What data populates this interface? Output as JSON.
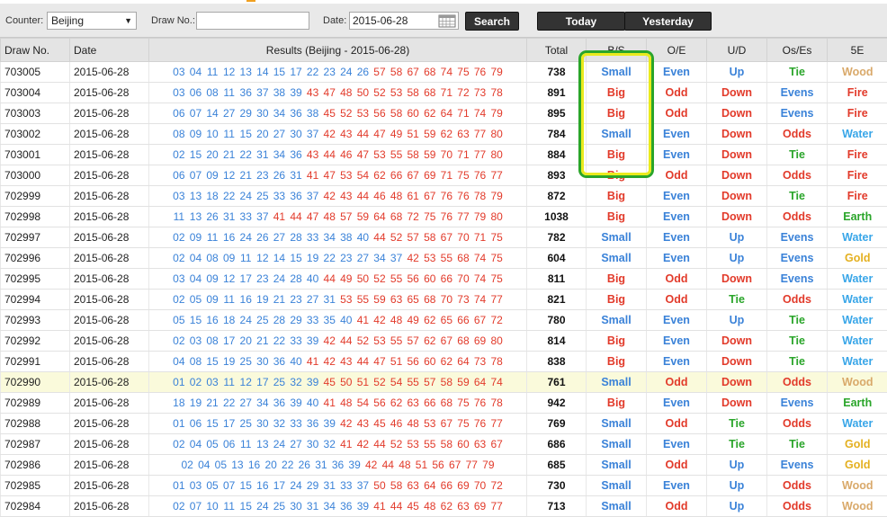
{
  "toolbar": {
    "counter_label": "Counter:",
    "counter_value": "Beijing",
    "drawno_label": "Draw No.:",
    "drawno_value": "",
    "date_label": "Date:",
    "date_value": "2015-06-28",
    "search_label": "Search",
    "today_label": "Today",
    "yesterday_label": "Yesterday"
  },
  "table": {
    "headers": [
      "Draw No.",
      "Date",
      "Results (Beijing - 2015-06-28)",
      "Total",
      "B/S",
      "O/E",
      "U/D",
      "Os/Es",
      "5E"
    ],
    "rows": [
      {
        "draw": "703005",
        "date": "2015-06-28",
        "nums": [
          "03",
          "04",
          "11",
          "12",
          "13",
          "14",
          "15",
          "17",
          "22",
          "23",
          "24",
          "26",
          "57",
          "58",
          "67",
          "68",
          "74",
          "75",
          "76",
          "79"
        ],
        "total": "738",
        "bs": "Small",
        "oe": "Even",
        "ud": "Up",
        "os": "Tie",
        "fe": "Wood"
      },
      {
        "draw": "703004",
        "date": "2015-06-28",
        "nums": [
          "03",
          "06",
          "08",
          "11",
          "36",
          "37",
          "38",
          "39",
          "43",
          "47",
          "48",
          "50",
          "52",
          "53",
          "58",
          "68",
          "71",
          "72",
          "73",
          "78"
        ],
        "total": "891",
        "bs": "Big",
        "oe": "Odd",
        "ud": "Down",
        "os": "Evens",
        "fe": "Fire"
      },
      {
        "draw": "703003",
        "date": "2015-06-28",
        "nums": [
          "06",
          "07",
          "14",
          "27",
          "29",
          "30",
          "34",
          "36",
          "38",
          "45",
          "52",
          "53",
          "56",
          "58",
          "60",
          "62",
          "64",
          "71",
          "74",
          "79"
        ],
        "total": "895",
        "bs": "Big",
        "oe": "Odd",
        "ud": "Down",
        "os": "Evens",
        "fe": "Fire"
      },
      {
        "draw": "703002",
        "date": "2015-06-28",
        "nums": [
          "08",
          "09",
          "10",
          "11",
          "15",
          "20",
          "27",
          "30",
          "37",
          "42",
          "43",
          "44",
          "47",
          "49",
          "51",
          "59",
          "62",
          "63",
          "77",
          "80"
        ],
        "total": "784",
        "bs": "Small",
        "oe": "Even",
        "ud": "Down",
        "os": "Odds",
        "fe": "Water"
      },
      {
        "draw": "703001",
        "date": "2015-06-28",
        "nums": [
          "02",
          "15",
          "20",
          "21",
          "22",
          "31",
          "34",
          "36",
          "43",
          "44",
          "46",
          "47",
          "53",
          "55",
          "58",
          "59",
          "70",
          "71",
          "77",
          "80"
        ],
        "total": "884",
        "bs": "Big",
        "oe": "Even",
        "ud": "Down",
        "os": "Tie",
        "fe": "Fire"
      },
      {
        "draw": "703000",
        "date": "2015-06-28",
        "nums": [
          "06",
          "07",
          "09",
          "12",
          "21",
          "23",
          "26",
          "31",
          "41",
          "47",
          "53",
          "54",
          "62",
          "66",
          "67",
          "69",
          "71",
          "75",
          "76",
          "77"
        ],
        "total": "893",
        "bs": "Big",
        "oe": "Odd",
        "ud": "Down",
        "os": "Odds",
        "fe": "Fire"
      },
      {
        "draw": "702999",
        "date": "2015-06-28",
        "nums": [
          "03",
          "13",
          "18",
          "22",
          "24",
          "25",
          "33",
          "36",
          "37",
          "42",
          "43",
          "44",
          "46",
          "48",
          "61",
          "67",
          "76",
          "76",
          "78",
          "79"
        ],
        "total": "872",
        "bs": "Big",
        "oe": "Even",
        "ud": "Down",
        "os": "Tie",
        "fe": "Fire"
      },
      {
        "draw": "702998",
        "date": "2015-06-28",
        "nums": [
          "11",
          "13",
          "26",
          "31",
          "33",
          "37",
          "41",
          "44",
          "47",
          "48",
          "57",
          "59",
          "64",
          "68",
          "72",
          "75",
          "76",
          "77",
          "79",
          "80"
        ],
        "total": "1038",
        "bs": "Big",
        "oe": "Even",
        "ud": "Down",
        "os": "Odds",
        "fe": "Earth"
      },
      {
        "draw": "702997",
        "date": "2015-06-28",
        "nums": [
          "02",
          "09",
          "11",
          "16",
          "24",
          "26",
          "27",
          "28",
          "33",
          "34",
          "38",
          "40",
          "44",
          "52",
          "57",
          "58",
          "67",
          "70",
          "71",
          "75"
        ],
        "total": "782",
        "bs": "Small",
        "oe": "Even",
        "ud": "Up",
        "os": "Evens",
        "fe": "Water"
      },
      {
        "draw": "702996",
        "date": "2015-06-28",
        "nums": [
          "02",
          "04",
          "08",
          "09",
          "11",
          "12",
          "14",
          "15",
          "19",
          "22",
          "23",
          "27",
          "34",
          "37",
          "42",
          "53",
          "55",
          "68",
          "74",
          "75"
        ],
        "total": "604",
        "bs": "Small",
        "oe": "Even",
        "ud": "Up",
        "os": "Evens",
        "fe": "Gold"
      },
      {
        "draw": "702995",
        "date": "2015-06-28",
        "nums": [
          "03",
          "04",
          "09",
          "12",
          "17",
          "23",
          "24",
          "28",
          "40",
          "44",
          "49",
          "50",
          "52",
          "55",
          "56",
          "60",
          "66",
          "70",
          "74",
          "75"
        ],
        "total": "811",
        "bs": "Big",
        "oe": "Odd",
        "ud": "Down",
        "os": "Evens",
        "fe": "Water"
      },
      {
        "draw": "702994",
        "date": "2015-06-28",
        "nums": [
          "02",
          "05",
          "09",
          "11",
          "16",
          "19",
          "21",
          "23",
          "27",
          "31",
          "53",
          "55",
          "59",
          "63",
          "65",
          "68",
          "70",
          "73",
          "74",
          "77"
        ],
        "total": "821",
        "bs": "Big",
        "oe": "Odd",
        "ud": "Tie",
        "os": "Odds",
        "fe": "Water"
      },
      {
        "draw": "702993",
        "date": "2015-06-28",
        "nums": [
          "05",
          "15",
          "16",
          "18",
          "24",
          "25",
          "28",
          "29",
          "33",
          "35",
          "40",
          "41",
          "42",
          "48",
          "49",
          "62",
          "65",
          "66",
          "67",
          "72"
        ],
        "total": "780",
        "bs": "Small",
        "oe": "Even",
        "ud": "Up",
        "os": "Tie",
        "fe": "Water"
      },
      {
        "draw": "702992",
        "date": "2015-06-28",
        "nums": [
          "02",
          "03",
          "08",
          "17",
          "20",
          "21",
          "22",
          "33",
          "39",
          "42",
          "44",
          "52",
          "53",
          "55",
          "57",
          "62",
          "67",
          "68",
          "69",
          "80"
        ],
        "total": "814",
        "bs": "Big",
        "oe": "Even",
        "ud": "Down",
        "os": "Tie",
        "fe": "Water"
      },
      {
        "draw": "702991",
        "date": "2015-06-28",
        "nums": [
          "04",
          "08",
          "15",
          "19",
          "25",
          "30",
          "36",
          "40",
          "41",
          "42",
          "43",
          "44",
          "47",
          "51",
          "56",
          "60",
          "62",
          "64",
          "73",
          "78"
        ],
        "total": "838",
        "bs": "Big",
        "oe": "Even",
        "ud": "Down",
        "os": "Tie",
        "fe": "Water"
      },
      {
        "draw": "702990",
        "date": "2015-06-28",
        "nums": [
          "01",
          "02",
          "03",
          "11",
          "12",
          "17",
          "25",
          "32",
          "39",
          "45",
          "50",
          "51",
          "52",
          "54",
          "55",
          "57",
          "58",
          "59",
          "64",
          "74"
        ],
        "total": "761",
        "bs": "Small",
        "oe": "Odd",
        "ud": "Down",
        "os": "Odds",
        "fe": "Wood"
      },
      {
        "draw": "702989",
        "date": "2015-06-28",
        "nums": [
          "18",
          "19",
          "21",
          "22",
          "27",
          "34",
          "36",
          "39",
          "40",
          "41",
          "48",
          "54",
          "56",
          "62",
          "63",
          "66",
          "68",
          "75",
          "76",
          "78"
        ],
        "total": "942",
        "bs": "Big",
        "oe": "Even",
        "ud": "Down",
        "os": "Evens",
        "fe": "Earth"
      },
      {
        "draw": "702988",
        "date": "2015-06-28",
        "nums": [
          "01",
          "06",
          "15",
          "17",
          "25",
          "30",
          "32",
          "33",
          "36",
          "39",
          "42",
          "43",
          "45",
          "46",
          "48",
          "53",
          "67",
          "75",
          "76",
          "77"
        ],
        "total": "769",
        "bs": "Small",
        "oe": "Odd",
        "ud": "Tie",
        "os": "Odds",
        "fe": "Water"
      },
      {
        "draw": "702987",
        "date": "2015-06-28",
        "nums": [
          "02",
          "04",
          "05",
          "06",
          "11",
          "13",
          "24",
          "27",
          "30",
          "32",
          "41",
          "42",
          "44",
          "52",
          "53",
          "55",
          "58",
          "60",
          "63",
          "67"
        ],
        "total": "686",
        "bs": "Small",
        "oe": "Even",
        "ud": "Tie",
        "os": "Tie",
        "fe": "Gold"
      },
      {
        "draw": "702986",
        "date": "2015-06-28",
        "nums": [
          "02",
          "04",
          "05",
          "13",
          "16",
          "20",
          "22",
          "26",
          "31",
          "36",
          "39",
          "42",
          "44",
          "48",
          "51",
          "56",
          "67",
          "77",
          "79"
        ],
        "total": "685",
        "bs": "Small",
        "oe": "Odd",
        "ud": "Up",
        "os": "Evens",
        "fe": "Gold"
      },
      {
        "draw": "702985",
        "date": "2015-06-28",
        "nums": [
          "01",
          "03",
          "05",
          "07",
          "15",
          "16",
          "17",
          "24",
          "29",
          "31",
          "33",
          "37",
          "50",
          "58",
          "63",
          "64",
          "66",
          "69",
          "70",
          "72"
        ],
        "total": "730",
        "bs": "Small",
        "oe": "Even",
        "ud": "Up",
        "os": "Odds",
        "fe": "Wood"
      },
      {
        "draw": "702984",
        "date": "2015-06-28",
        "nums": [
          "02",
          "07",
          "10",
          "11",
          "15",
          "24",
          "25",
          "30",
          "31",
          "34",
          "36",
          "39",
          "41",
          "44",
          "45",
          "48",
          "62",
          "63",
          "69",
          "77"
        ],
        "total": "713",
        "bs": "Small",
        "oe": "Odd",
        "ud": "Up",
        "os": "Odds",
        "fe": "Wood"
      }
    ]
  },
  "colors": {
    "blue": "#3a82d8",
    "red": "#e23a2a",
    "green": "#2aa52a",
    "gold": "#e4b020",
    "wood": "#d9a96a",
    "water": "#39a6e8",
    "highlight_row": "#fafadb",
    "annotation_yellow": "#eaea1e",
    "annotation_green": "#2aa52a"
  },
  "highlighted_draw": "702990",
  "icons": {
    "calendar": "calendar-icon",
    "dropdown": "chevron-down-icon"
  }
}
